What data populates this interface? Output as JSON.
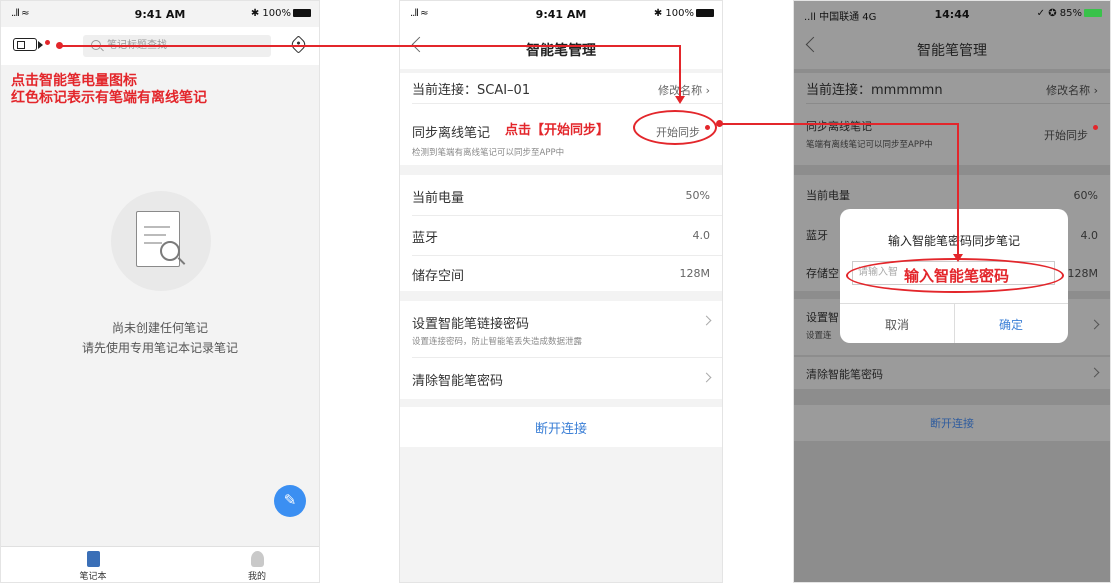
{
  "phone1": {
    "status": {
      "signal": "..ll ≈",
      "time": "9:41 AM",
      "battery": "✱ 100%"
    },
    "search_placeholder": "笔记标题查找",
    "annotation_line1": "点击智能笔电量图标",
    "annotation_line2": "红色标记表示有笔端有离线笔记",
    "empty_line1": "尚未创建任何笔记",
    "empty_line2": "请先使用专用笔记本记录笔记",
    "tabs": [
      {
        "label": "笔记本",
        "icon": "notebook-icon"
      },
      {
        "label": "我的",
        "icon": "person-icon"
      }
    ]
  },
  "phone2": {
    "status": {
      "signal": "..ll ≈",
      "time": "9:41 AM",
      "battery": "✱ 100%"
    },
    "title": "智能笔管理",
    "connection_label": "当前连接：SCAI–01",
    "rename": "修改名称 ›",
    "sync_label": "同步离线笔记",
    "sync_sub": "检测到笔端有离线笔记可以同步至APP中",
    "sync_action": "开始同步",
    "annotation_sync": "点击【开始同步】",
    "battery_label": "当前电量",
    "battery_value": "50%",
    "bluetooth_label": "蓝牙",
    "bluetooth_value": "4.0",
    "storage_label": "储存空间",
    "storage_value": "128M",
    "set_password_label": "设置智能笔链接密码",
    "set_password_sub": "设置连接密码，防止智能笔丢失造成数据泄露",
    "clear_password_label": "清除智能笔密码",
    "disconnect": "断开连接"
  },
  "phone3": {
    "status": {
      "signal": "..ll 中国联通 4G",
      "time": "14:44",
      "battery": "✓ ✪ 85%"
    },
    "title": "智能笔管理",
    "connection_label": "当前连接：mmmmmn",
    "rename": "修改名称 ›",
    "sync_label": "同步离线笔记",
    "sync_sub": "笔端有离线笔记可以同步至APP中",
    "sync_action": "开始同步",
    "battery_label": "当前电量",
    "battery_value": "60%",
    "bluetooth_label": "蓝牙",
    "bluetooth_value": "4.0",
    "storage_label": "存储空",
    "storage_value": "128M",
    "set_password_label": "设置智",
    "set_password_sub": "设置连",
    "clear_password_label": "清除智能笔密码",
    "disconnect": "断开连接",
    "dialog": {
      "title": "输入智能笔密码同步笔记",
      "placeholder": "请输入智",
      "cancel": "取消",
      "confirm": "确定"
    },
    "annotation_password": "输入智能笔密码"
  },
  "colors": {
    "annotation": "#e3262b",
    "link": "#3b7fd6",
    "fab": "#3b8ff2"
  }
}
